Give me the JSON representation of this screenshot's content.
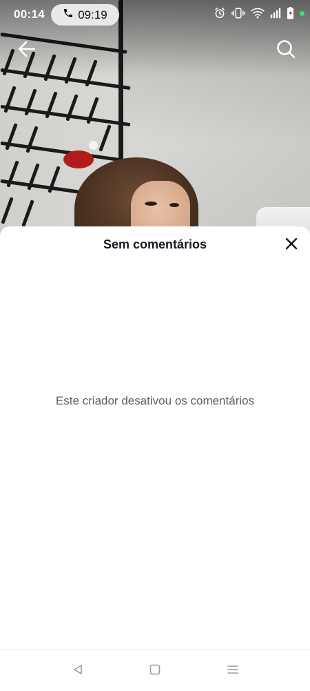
{
  "status_bar": {
    "time": "00:14",
    "call_duration": "09:19",
    "icons": [
      "alarm-icon",
      "vibrate-icon",
      "wifi-icon",
      "signal-icon",
      "battery-icon",
      "active-dot"
    ],
    "dot_color": "#3ddc84"
  },
  "video_nav": {
    "back_icon": "arrow-left-icon",
    "search_icon": "search-icon"
  },
  "comments_sheet": {
    "title": "Sem comentários",
    "close_icon": "close-icon",
    "empty_message": "Este criador desativou os comentários"
  },
  "system_nav": {
    "buttons": [
      "back-triangle-icon",
      "home-square-icon",
      "menu-lines-icon"
    ]
  }
}
